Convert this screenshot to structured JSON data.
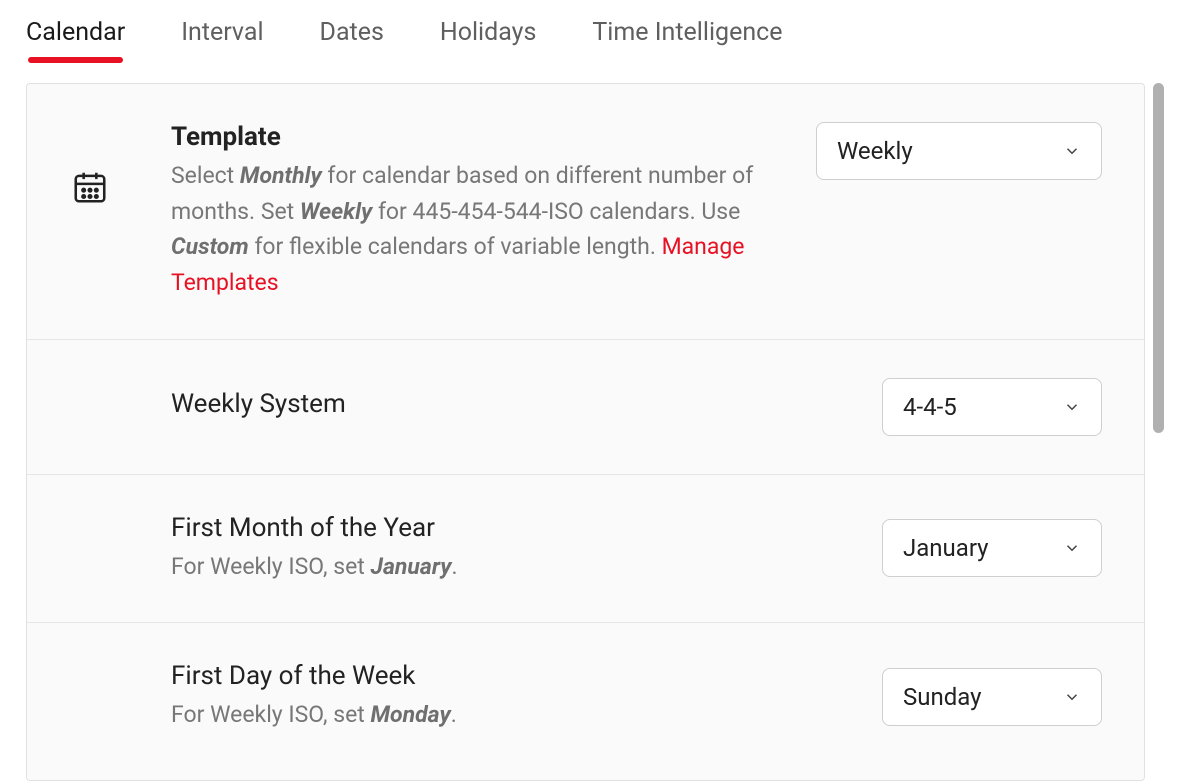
{
  "tabs": {
    "items": [
      {
        "label": "Calendar",
        "active": true
      },
      {
        "label": "Interval",
        "active": false
      },
      {
        "label": "Dates",
        "active": false
      },
      {
        "label": "Holidays",
        "active": false
      },
      {
        "label": "Time Intelligence",
        "active": false
      }
    ]
  },
  "rows": {
    "template": {
      "title": "Template",
      "desc_parts": {
        "p1": "Select ",
        "b1": "Monthly",
        "p2": " for calendar based on different number of months. Set ",
        "b2": "Weekly",
        "p3": " for 445-454-544-ISO calendars. Use ",
        "b3": "Custom",
        "p4": " for flexible calendars of variable length. ",
        "link": "Manage Templates"
      },
      "selected": "Weekly"
    },
    "weekly_system": {
      "title": "Weekly System",
      "selected": "4-4-5"
    },
    "first_month": {
      "title": "First Month of the Year",
      "desc_parts": {
        "p1": "For Weekly ISO, set ",
        "b1": "January",
        "p2": "."
      },
      "selected": "January"
    },
    "first_day": {
      "title": "First Day of the Week",
      "desc_parts": {
        "p1": "For Weekly ISO, set ",
        "b1": "Monday",
        "p2": "."
      },
      "selected": "Sunday"
    }
  }
}
